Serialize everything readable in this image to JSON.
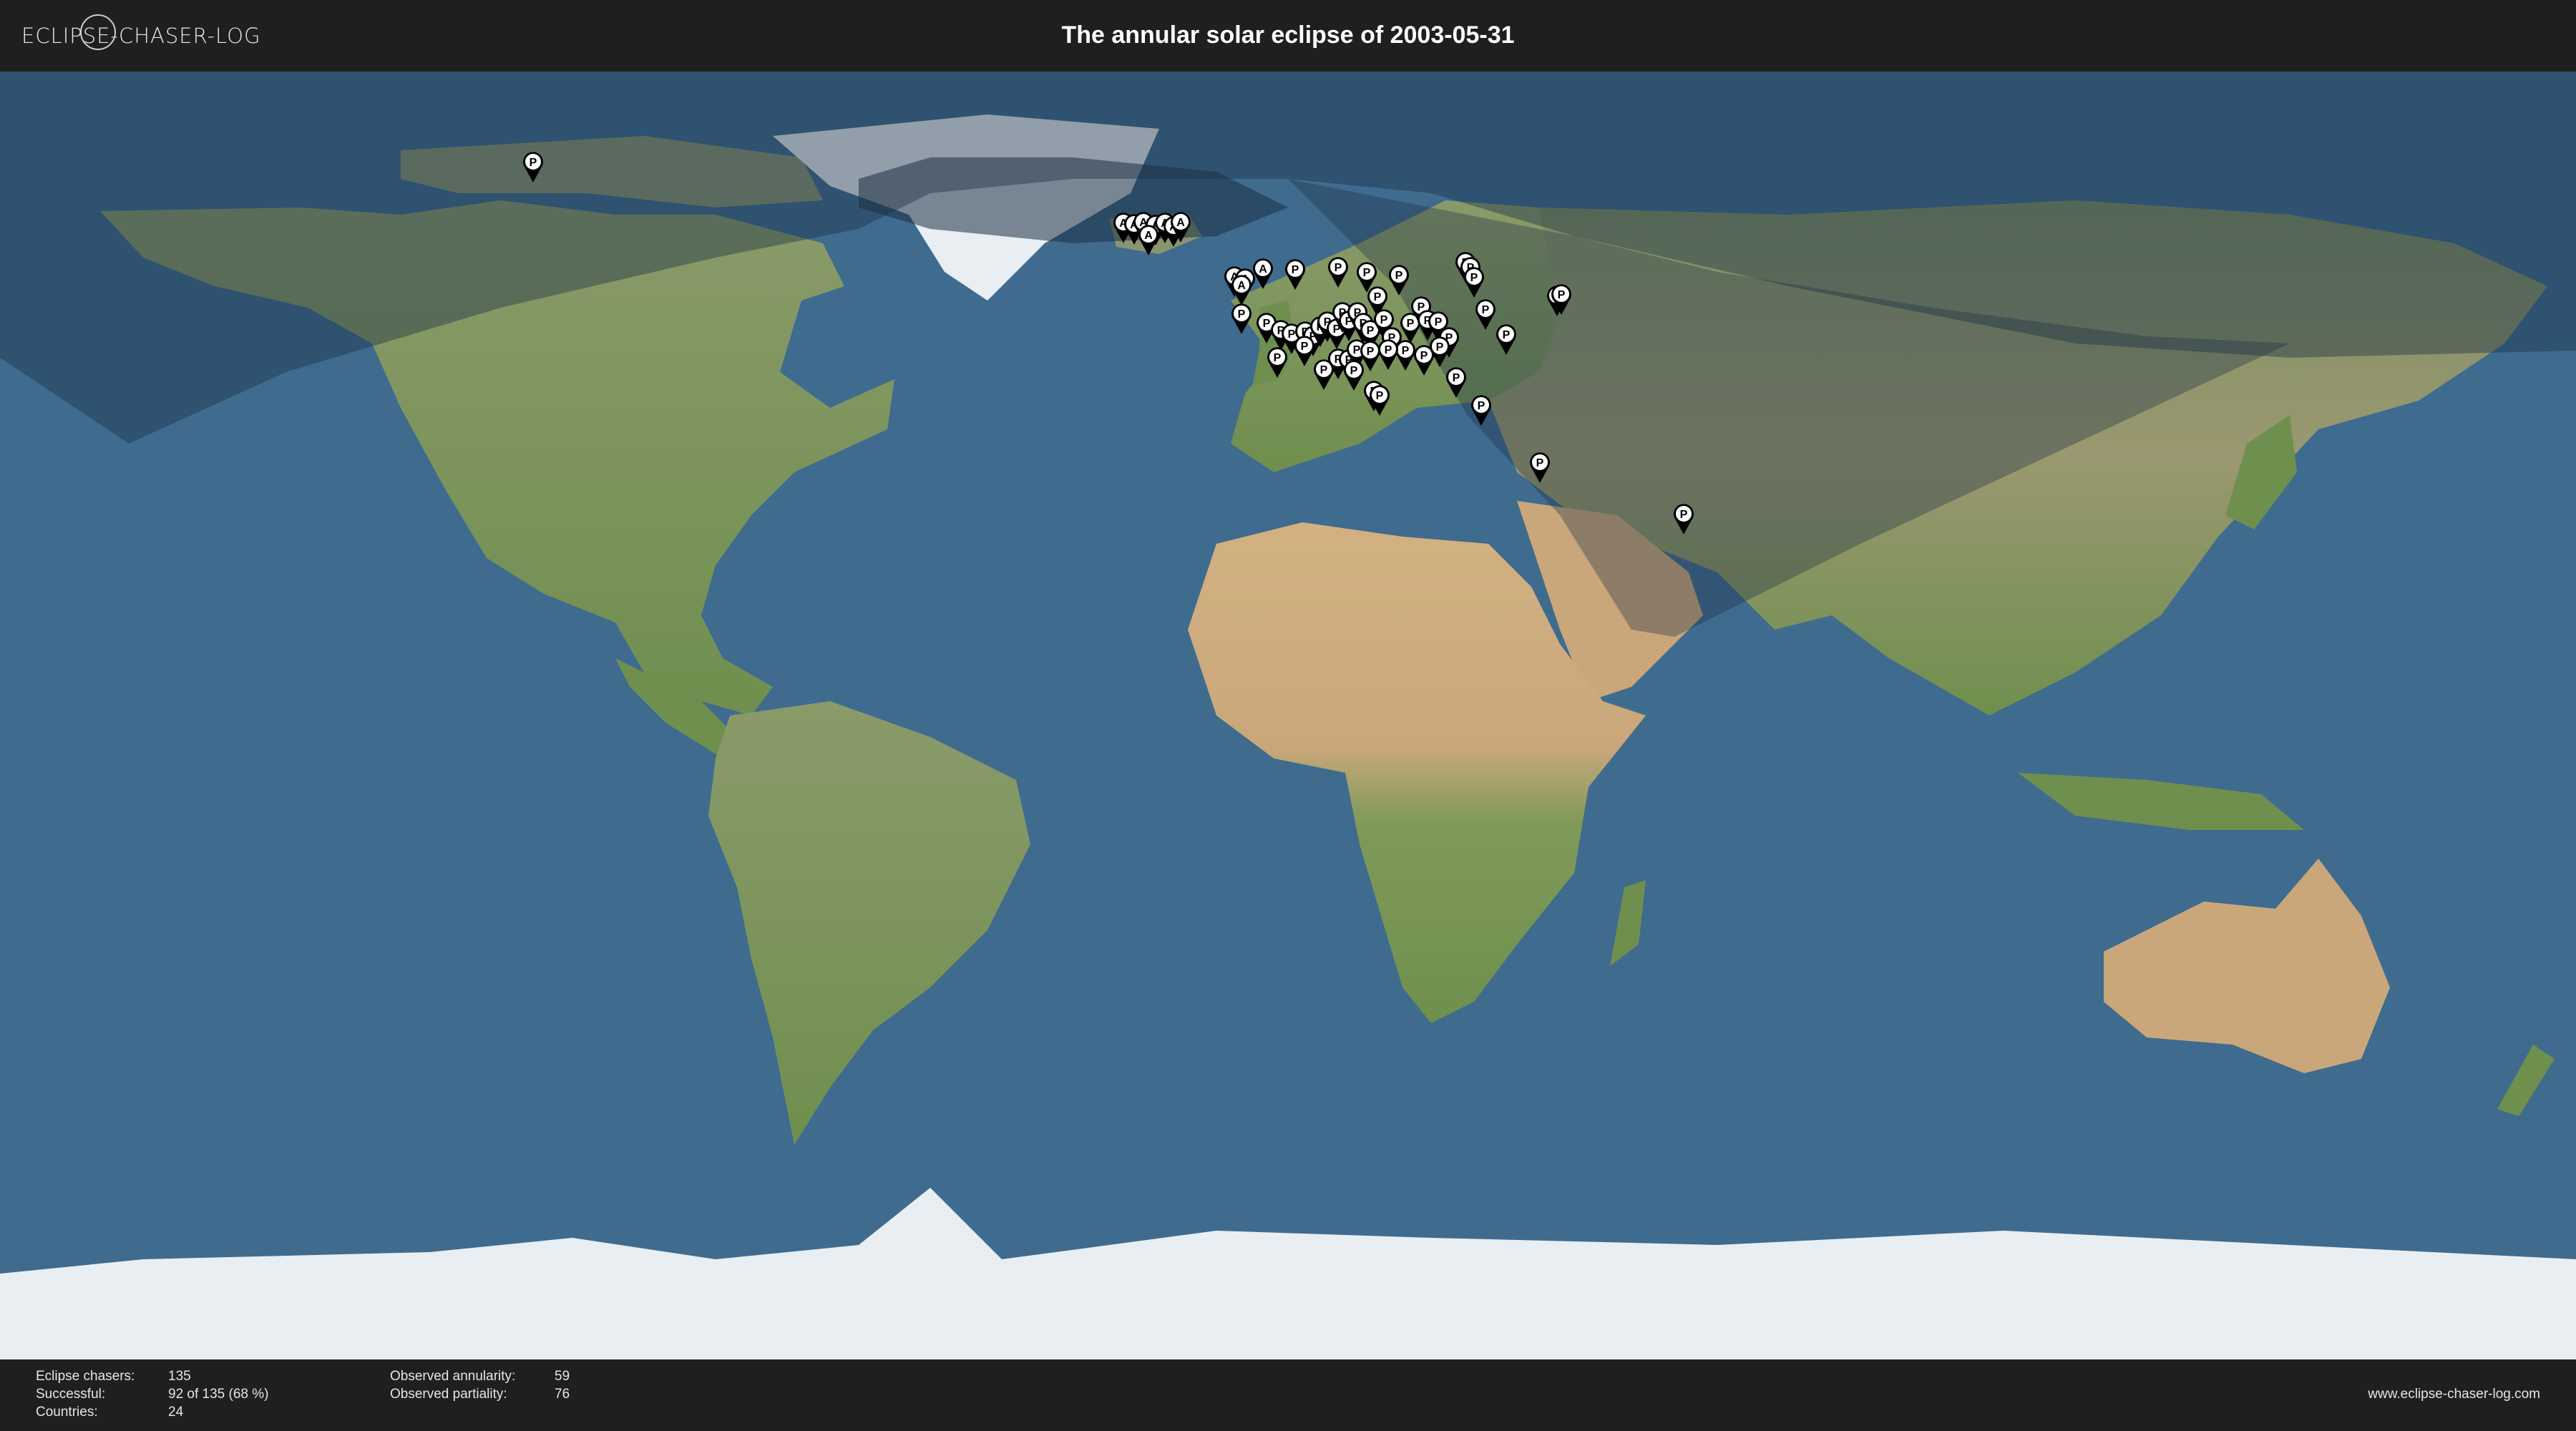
{
  "header": {
    "logo_text": "ECLIPSE-CHASER-LOG",
    "title": "The annular solar eclipse of 2003-05-31"
  },
  "map": {
    "colors": {
      "ocean": "#3f6b8f",
      "land": "#7d9a5a",
      "desert": "#c9a77a",
      "ice": "#e8eef2",
      "eclipse_shadow": "#1b2f45"
    },
    "marker_types": {
      "A": "annularity",
      "P": "partiality"
    },
    "markers": [
      {
        "label": "P",
        "lon": -105.5,
        "lat": 74.5
      },
      {
        "label": "A",
        "lon": -23.0,
        "lat": 66.0
      },
      {
        "label": "A",
        "lon": -21.5,
        "lat": 65.8
      },
      {
        "label": "A",
        "lon": -20.2,
        "lat": 66.1
      },
      {
        "label": "A",
        "lon": -18.5,
        "lat": 65.7
      },
      {
        "label": "A",
        "lon": -17.2,
        "lat": 66.0
      },
      {
        "label": "A",
        "lon": -16.0,
        "lat": 65.5
      },
      {
        "label": "A",
        "lon": -15.0,
        "lat": 66.1
      },
      {
        "label": "A",
        "lon": -19.5,
        "lat": 64.3
      },
      {
        "label": "A",
        "lon": -7.5,
        "lat": 58.5
      },
      {
        "label": "A",
        "lon": -6.0,
        "lat": 58.2
      },
      {
        "label": "A",
        "lon": -3.5,
        "lat": 59.6
      },
      {
        "label": "A",
        "lon": -6.5,
        "lat": 57.3
      },
      {
        "label": "P",
        "lon": 1.0,
        "lat": 59.5
      },
      {
        "label": "P",
        "lon": 7.0,
        "lat": 59.8
      },
      {
        "label": "P",
        "lon": 11.0,
        "lat": 59.1
      },
      {
        "label": "P",
        "lon": 15.5,
        "lat": 58.7
      },
      {
        "label": "P",
        "lon": 24.8,
        "lat": 60.5
      },
      {
        "label": "P",
        "lon": 25.5,
        "lat": 59.8
      },
      {
        "label": "P",
        "lon": 37.6,
        "lat": 55.8
      },
      {
        "label": "P",
        "lon": 38.2,
        "lat": 56.0
      },
      {
        "label": "P",
        "lon": -6.5,
        "lat": 53.3
      },
      {
        "label": "P",
        "lon": -3.0,
        "lat": 52.0
      },
      {
        "label": "P",
        "lon": -1.0,
        "lat": 51.0
      },
      {
        "label": "P",
        "lon": 0.5,
        "lat": 50.5
      },
      {
        "label": "P",
        "lon": 2.4,
        "lat": 50.8
      },
      {
        "label": "P",
        "lon": 3.5,
        "lat": 50.2
      },
      {
        "label": "P",
        "lon": 4.5,
        "lat": 51.5
      },
      {
        "label": "P",
        "lon": 5.5,
        "lat": 52.2
      },
      {
        "label": "P",
        "lon": 6.8,
        "lat": 51.2
      },
      {
        "label": "P",
        "lon": 7.6,
        "lat": 53.5
      },
      {
        "label": "P",
        "lon": 8.5,
        "lat": 52.3
      },
      {
        "label": "P",
        "lon": 9.7,
        "lat": 53.5
      },
      {
        "label": "P",
        "lon": 10.5,
        "lat": 52.0
      },
      {
        "label": "P",
        "lon": 11.5,
        "lat": 51.0
      },
      {
        "label": "P",
        "lon": 12.5,
        "lat": 55.7
      },
      {
        "label": "P",
        "lon": 13.4,
        "lat": 52.5
      },
      {
        "label": "P",
        "lon": 14.5,
        "lat": 50.0
      },
      {
        "label": "P",
        "lon": 16.4,
        "lat": 48.2
      },
      {
        "label": "P",
        "lon": 17.1,
        "lat": 52.0
      },
      {
        "label": "P",
        "lon": 18.6,
        "lat": 54.3
      },
      {
        "label": "P",
        "lon": 19.5,
        "lat": 52.4
      },
      {
        "label": "P",
        "lon": 21.0,
        "lat": 52.2
      },
      {
        "label": "P",
        "lon": 22.5,
        "lat": 50.0
      },
      {
        "label": "P",
        "lon": 30.5,
        "lat": 50.4
      },
      {
        "label": "P",
        "lon": -1.5,
        "lat": 47.2
      },
      {
        "label": "P",
        "lon": 2.3,
        "lat": 48.8
      },
      {
        "label": "P",
        "lon": 5.0,
        "lat": 45.5
      },
      {
        "label": "P",
        "lon": 7.0,
        "lat": 47.0
      },
      {
        "label": "P",
        "lon": 8.5,
        "lat": 46.9
      },
      {
        "label": "P",
        "lon": 9.6,
        "lat": 48.3
      },
      {
        "label": "P",
        "lon": 11.5,
        "lat": 48.1
      },
      {
        "label": "P",
        "lon": 14.0,
        "lat": 48.3
      },
      {
        "label": "P",
        "lon": 19.0,
        "lat": 47.5
      },
      {
        "label": "P",
        "lon": 21.2,
        "lat": 48.7
      },
      {
        "label": "P",
        "lon": 23.5,
        "lat": 44.4
      },
      {
        "label": "P",
        "lon": 9.2,
        "lat": 45.4
      },
      {
        "label": "P",
        "lon": 12.0,
        "lat": 42.5
      },
      {
        "label": "P",
        "lon": 12.8,
        "lat": 41.9
      },
      {
        "label": "P",
        "lon": 27.0,
        "lat": 40.5
      },
      {
        "label": "P",
        "lon": 35.2,
        "lat": 32.5
      },
      {
        "label": "P",
        "lon": 55.3,
        "lat": 25.3
      },
      {
        "label": "P",
        "lon": 26.0,
        "lat": 58.4
      },
      {
        "label": "P",
        "lon": 27.6,
        "lat": 53.9
      }
    ]
  },
  "footer": {
    "stats_left": [
      {
        "label": "Eclipse chasers:",
        "value": "135"
      },
      {
        "label": "Successful:",
        "value": "92 of 135 (68 %)"
      },
      {
        "label": "Countries:",
        "value": "24"
      }
    ],
    "stats_right": [
      {
        "label": "Observed annularity:",
        "value": "59"
      },
      {
        "label": "Observed partiality:",
        "value": "76"
      }
    ],
    "website": "www.eclipse-chaser-log.com"
  }
}
